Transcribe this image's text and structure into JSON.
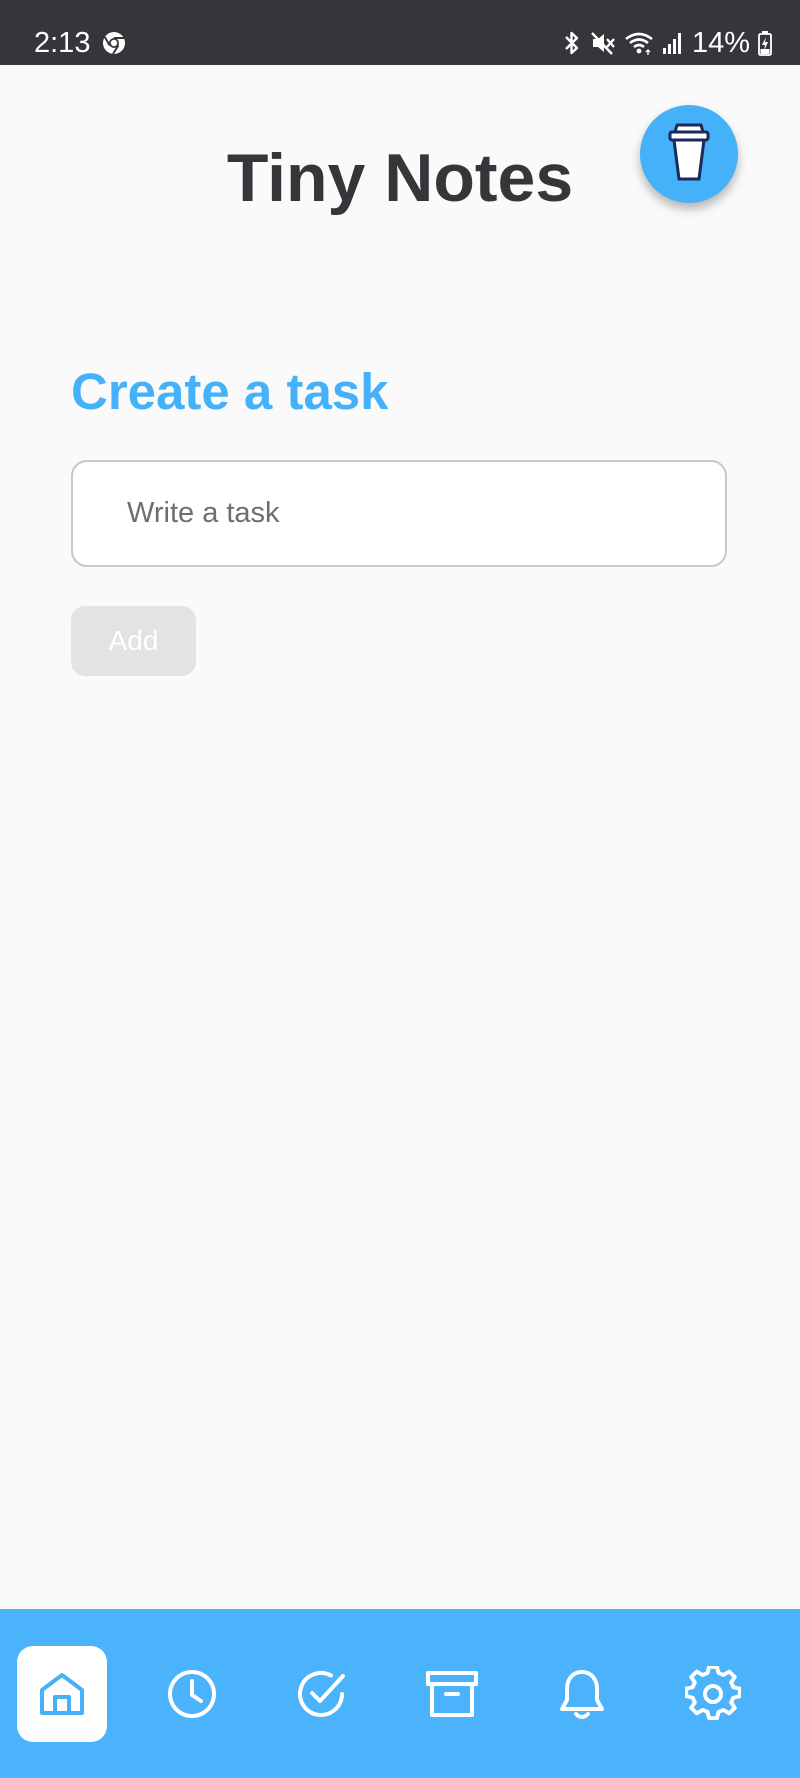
{
  "status_bar": {
    "time": "2:13",
    "battery": "14%"
  },
  "header": {
    "title": "Tiny Notes",
    "coffee_icon": "coffee-cup-icon"
  },
  "create_task": {
    "heading": "Create a task",
    "input_placeholder": "Write a task",
    "input_value": "",
    "add_label": "Add"
  },
  "bottom_nav": {
    "items": [
      {
        "icon": "home-icon",
        "active": true
      },
      {
        "icon": "clock-icon",
        "active": false
      },
      {
        "icon": "check-circle-icon",
        "active": false
      },
      {
        "icon": "archive-icon",
        "active": false
      },
      {
        "icon": "bell-icon",
        "active": false
      },
      {
        "icon": "gear-icon",
        "active": false
      }
    ]
  },
  "colors": {
    "accent": "#45b1f9",
    "nav_background": "#4ab3fb",
    "title_text": "#35363a",
    "status_bar": "#35363a",
    "disabled_button": "#e3e3e3",
    "background": "#fafafa"
  }
}
